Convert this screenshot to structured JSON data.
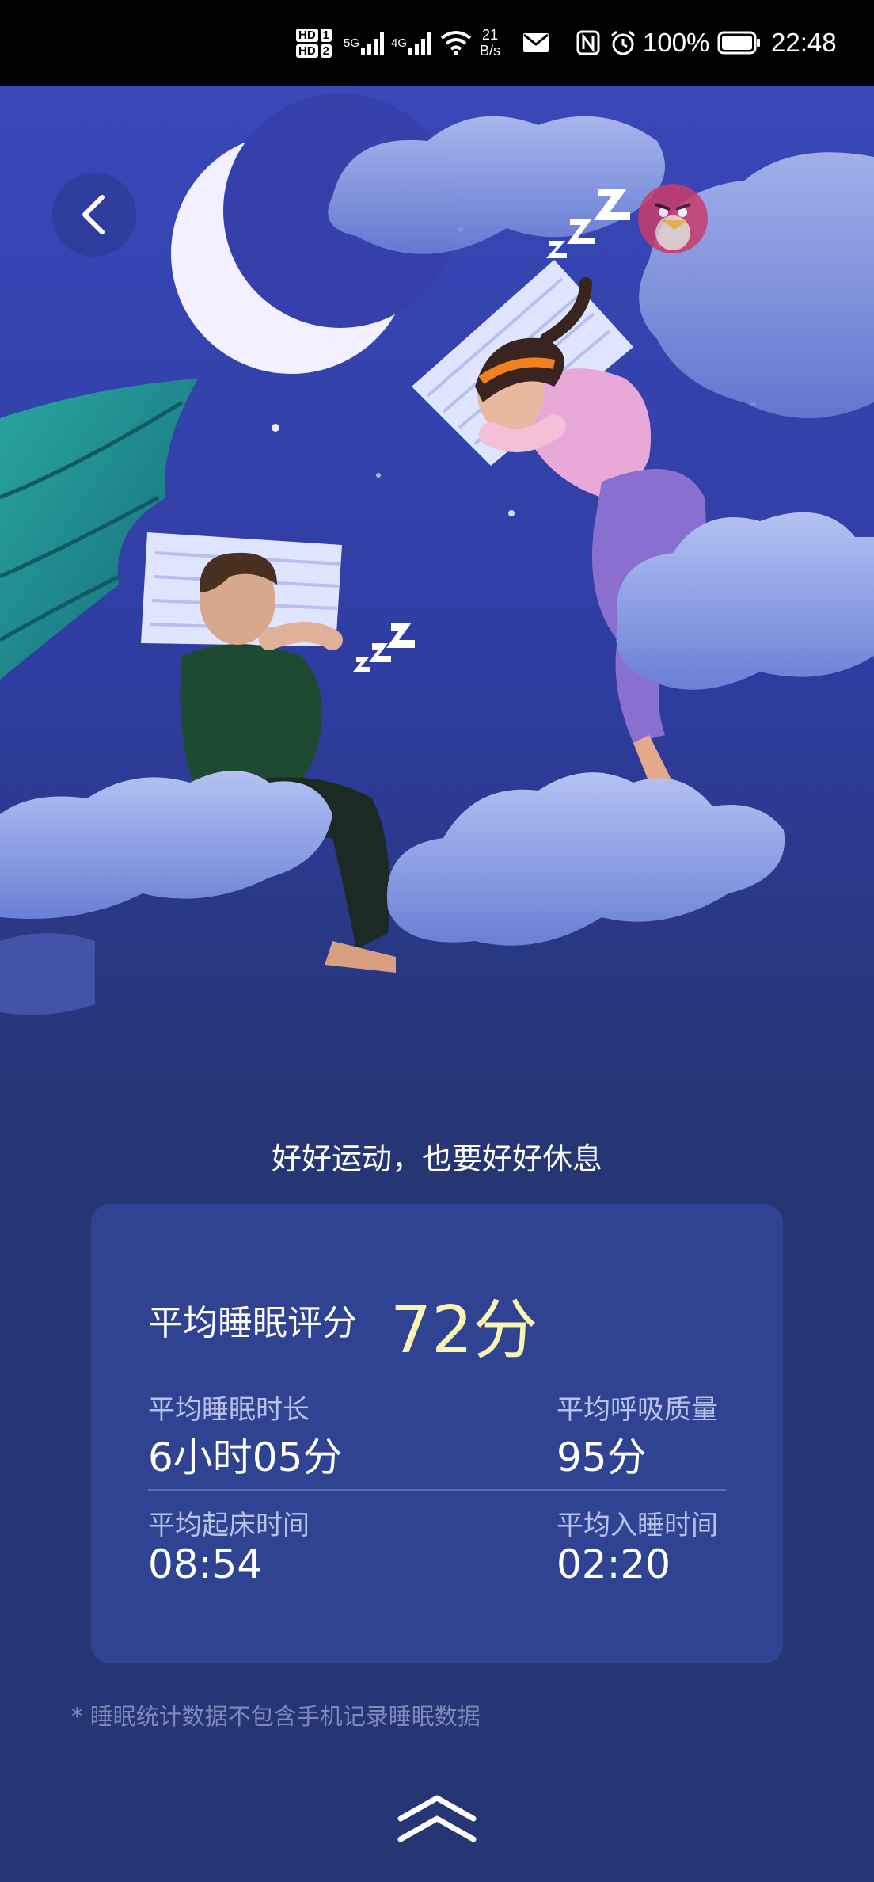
{
  "status_bar": {
    "sim1": "HD",
    "sim1_num": "1",
    "sim2": "HD",
    "sim2_num": "2",
    "net1": "5G",
    "net2": "4G",
    "speed_value": "21",
    "speed_unit": "B/s",
    "battery": "100%",
    "time": "22:48"
  },
  "tagline": "好好运动，也要好好休息",
  "sleep_card": {
    "score_label": "平均睡眠评分",
    "score_value": "72分",
    "metrics": [
      {
        "label": "平均睡眠时长",
        "value": "6小时05分"
      },
      {
        "label": "平均呼吸质量",
        "value": "95分"
      },
      {
        "label": "平均起床时间",
        "value": "08:54"
      },
      {
        "label": "平均入睡时间",
        "value": "02:20"
      }
    ]
  },
  "footnote": "* 睡眠统计数据不包含手机记录睡眠数据",
  "colors": {
    "background": "#263573",
    "card": "#2f4392",
    "score_accent": "#fbf3b0"
  },
  "icons": [
    "back-arrow-icon",
    "angry-bird-icon",
    "swipe-up-icon"
  ]
}
